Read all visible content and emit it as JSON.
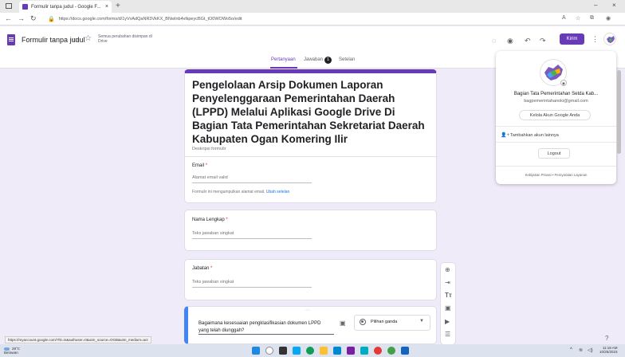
{
  "browser": {
    "tab_title": "Formulir tanpa judul - Google F...",
    "url": "https://docs.google.com/forms/d/1yVvAdQaNR3VkKX_BNwInb4vlkpeycBGt_tO0WOWo5o/edit",
    "status_url": "https://myaccount.google.com/?hl=in&authuser=0&utm_source=OGB&utm_medium=act"
  },
  "header": {
    "doc_title": "Formulir tanpa judul",
    "saved_status": "Semua perubahan disimpan di Drive",
    "send_label": "Kirim",
    "accent": "#673ab7"
  },
  "form_tabs": [
    {
      "label": "Pertanyaan",
      "active": true
    },
    {
      "label": "Jawaban",
      "badge": "1"
    },
    {
      "label": "Setelan"
    }
  ],
  "form": {
    "title": "Pengelolaan Arsip Dokumen Laporan Penyelenggaraan Pemerintahan Daerah (LPPD) Melalui Aplikasi Google Drive Di Bagian Tata Pemerintahan Sekretariat Daerah Kabupaten Ogan Komering Ilir",
    "description_placeholder": "Deskripsi formulir",
    "email_label": "Email",
    "email_placeholder": "Alamat email valid",
    "collect_text": "Formulir ini mengumpulkan alamat email.",
    "collect_link": "Ubah setelan"
  },
  "questions": [
    {
      "label": "Nama Lengkap",
      "placeholder": "Teks jawaban singkat"
    },
    {
      "label": "Jabatan",
      "placeholder": "Teks jawaban singkat"
    },
    {
      "label": "Bagaimana kesesuaian pengklasifikasian dokumen LPPD yang telah diunggah?",
      "type": "Pilihan ganda"
    }
  ],
  "account_popup": {
    "name": "Bagian Tata Pemerintahan Setda Kab...",
    "email": "bagpemerintahanoki@gmail.com",
    "manage_label": "Kelola Akun Google Anda",
    "add_account_label": "Tambahkan akun lainnya",
    "logout_label": "Logout",
    "privacy_label": "Kebijakan Privasi",
    "terms_label": "Persyaratan Layanan"
  },
  "taskbar": {
    "temp": "28°C",
    "weather_desc": "Berawan",
    "time": "11:18 AM",
    "date": "10/25/2023"
  }
}
